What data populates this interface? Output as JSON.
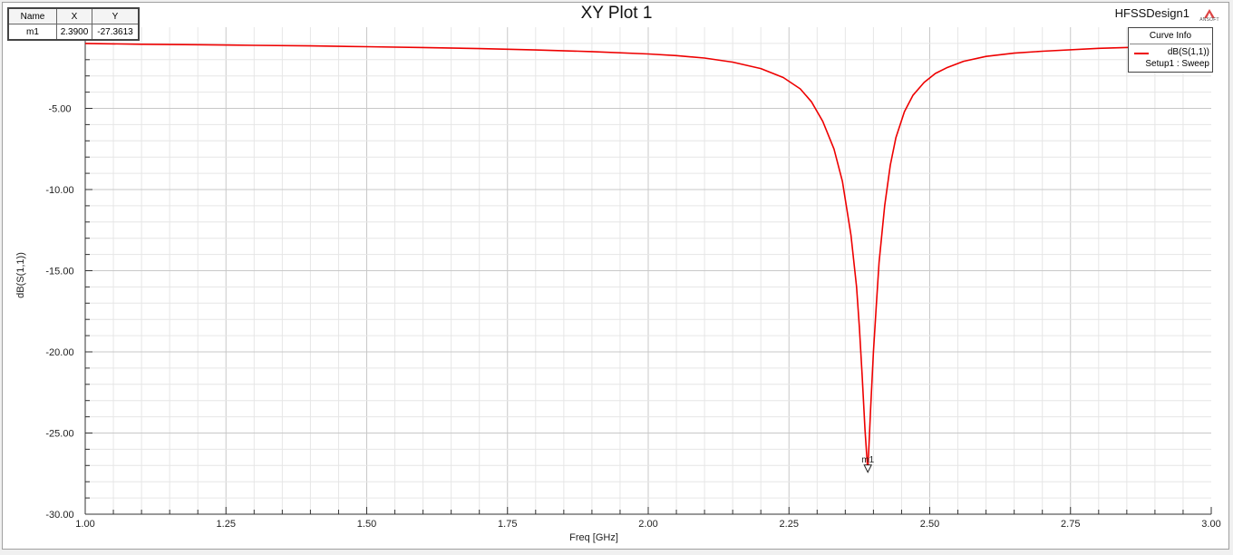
{
  "window": {
    "title": "XY Plot 1",
    "design_name": "HFSSDesign1",
    "logo_text": "ANSOFT"
  },
  "marker_table": {
    "headers": [
      "Name",
      "X",
      "Y"
    ],
    "rows": [
      [
        "m1",
        "2.3900",
        "-27.3613"
      ]
    ]
  },
  "curve_info": {
    "header": "Curve Info",
    "curve_name": "dB(S(1,1))",
    "setup": "Setup1 : Sweep",
    "color": "#ee0000"
  },
  "chart_data": {
    "type": "line",
    "title": "XY Plot 1",
    "xlabel": "Freq [GHz]",
    "ylabel": "dB(S(1,1))",
    "xlim": [
      1.0,
      3.0
    ],
    "ylim": [
      -30.0,
      0.0
    ],
    "x_ticks": [
      "1.00",
      "1.25",
      "1.50",
      "1.75",
      "2.00",
      "2.25",
      "2.50",
      "2.75",
      "3.00"
    ],
    "x_tick_values": [
      1.0,
      1.25,
      1.5,
      1.75,
      2.0,
      2.25,
      2.5,
      2.75,
      3.0
    ],
    "y_ticks": [
      "-5.00",
      "-10.00",
      "-15.00",
      "-20.00",
      "-25.00",
      "-30.00"
    ],
    "y_tick_values": [
      -5,
      -10,
      -15,
      -20,
      -25,
      -30
    ],
    "grid": true,
    "legend": "top-right",
    "series": [
      {
        "name": "dB(S(1,1))",
        "color": "#ee0000",
        "x": [
          1.0,
          1.1,
          1.2,
          1.3,
          1.4,
          1.5,
          1.6,
          1.7,
          1.8,
          1.9,
          2.0,
          2.05,
          2.1,
          2.15,
          2.2,
          2.24,
          2.27,
          2.29,
          2.31,
          2.33,
          2.345,
          2.36,
          2.37,
          2.375,
          2.38,
          2.385,
          2.39,
          2.395,
          2.4,
          2.405,
          2.41,
          2.42,
          2.43,
          2.44,
          2.455,
          2.47,
          2.49,
          2.51,
          2.53,
          2.56,
          2.6,
          2.65,
          2.7,
          2.8,
          2.9,
          3.0
        ],
        "values": [
          -1.0,
          -1.05,
          -1.08,
          -1.12,
          -1.15,
          -1.2,
          -1.25,
          -1.32,
          -1.4,
          -1.5,
          -1.65,
          -1.75,
          -1.9,
          -2.15,
          -2.55,
          -3.1,
          -3.8,
          -4.6,
          -5.8,
          -7.5,
          -9.5,
          -12.8,
          -16.0,
          -18.5,
          -21.5,
          -24.8,
          -27.36,
          -23.5,
          -20.0,
          -17.2,
          -14.5,
          -11.0,
          -8.5,
          -6.8,
          -5.2,
          -4.2,
          -3.4,
          -2.85,
          -2.5,
          -2.1,
          -1.8,
          -1.6,
          -1.48,
          -1.3,
          -1.2,
          -1.12
        ]
      }
    ],
    "markers": [
      {
        "name": "m1",
        "x": 2.39,
        "y": -27.3613
      }
    ]
  }
}
